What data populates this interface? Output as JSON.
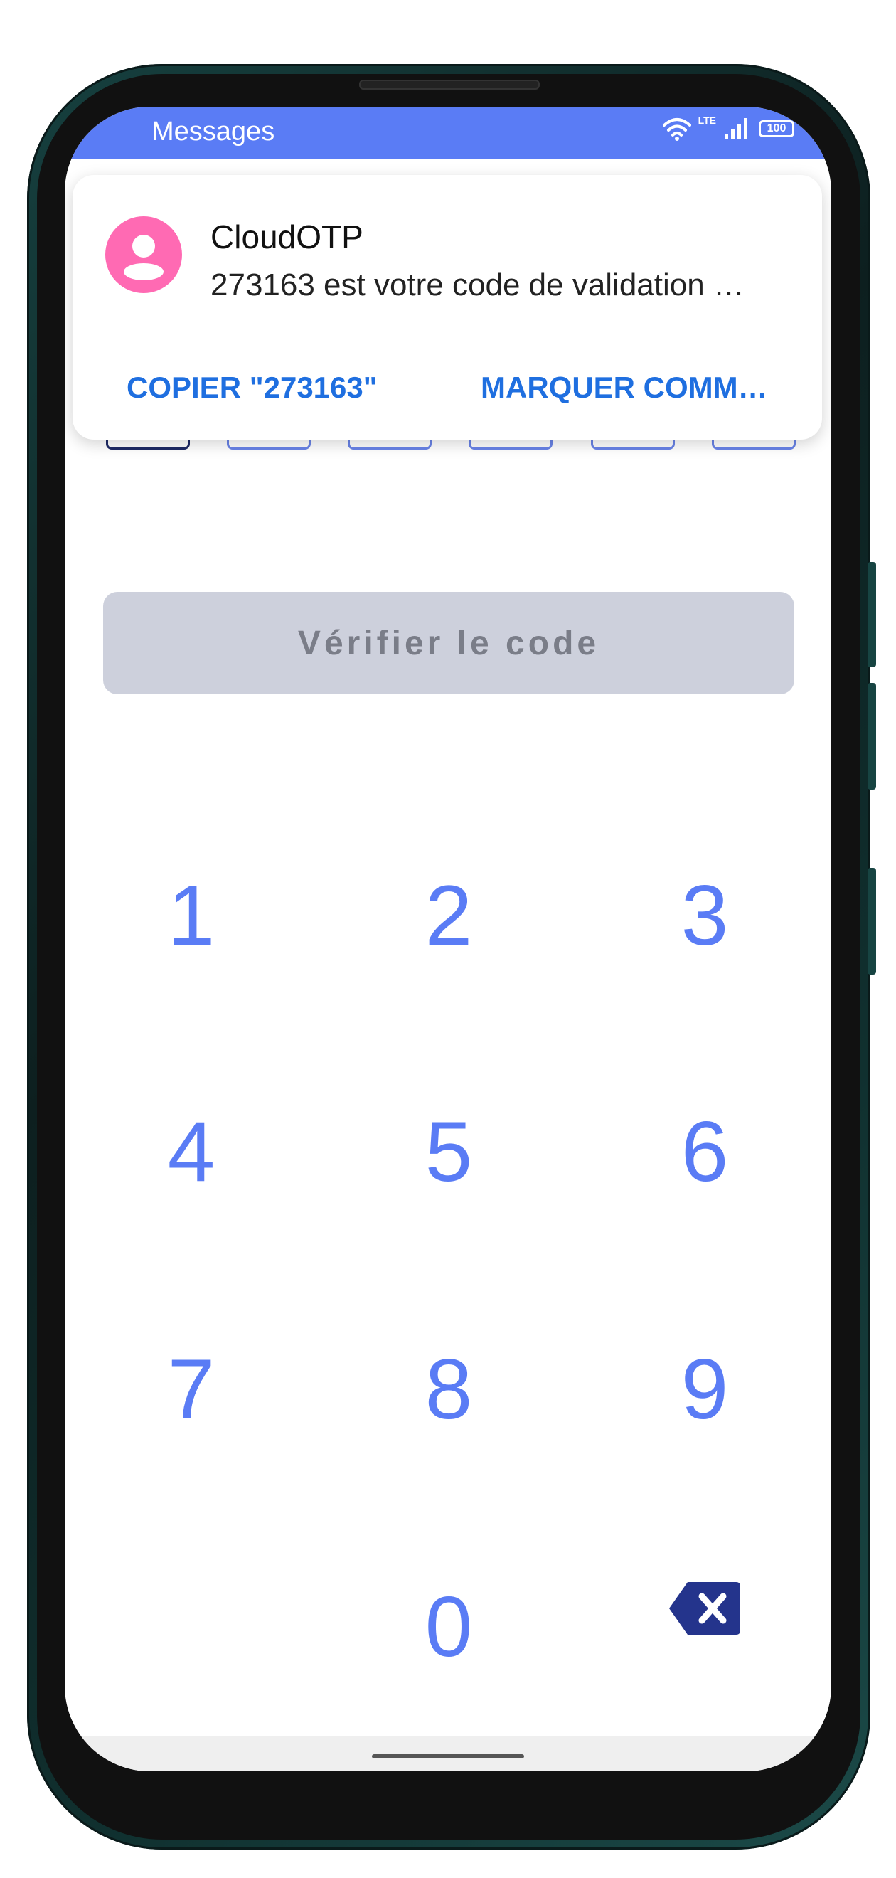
{
  "status_bar": {
    "app_name": "Messages",
    "network": "LTE",
    "battery": "100"
  },
  "notification": {
    "sender": "CloudOTP",
    "message": "273163 est votre code de validation …",
    "action_copy": "COPIER \"273163\"",
    "action_mark": "MARQUER COMM…",
    "avatar_color": "#ff6ab3"
  },
  "otp": {
    "digits": [
      "",
      "",
      "",
      "",
      "",
      ""
    ]
  },
  "verify_button": {
    "label": "Vérifier le code"
  },
  "keypad": {
    "keys": [
      "1",
      "2",
      "3",
      "4",
      "5",
      "6",
      "7",
      "8",
      "9",
      "0"
    ],
    "backspace_icon": "backspace-icon"
  },
  "colors": {
    "accent": "#5a7cf5",
    "action_link": "#1f6fe0",
    "button_disabled": "#cdd0dc",
    "backspace": "#24348c"
  }
}
